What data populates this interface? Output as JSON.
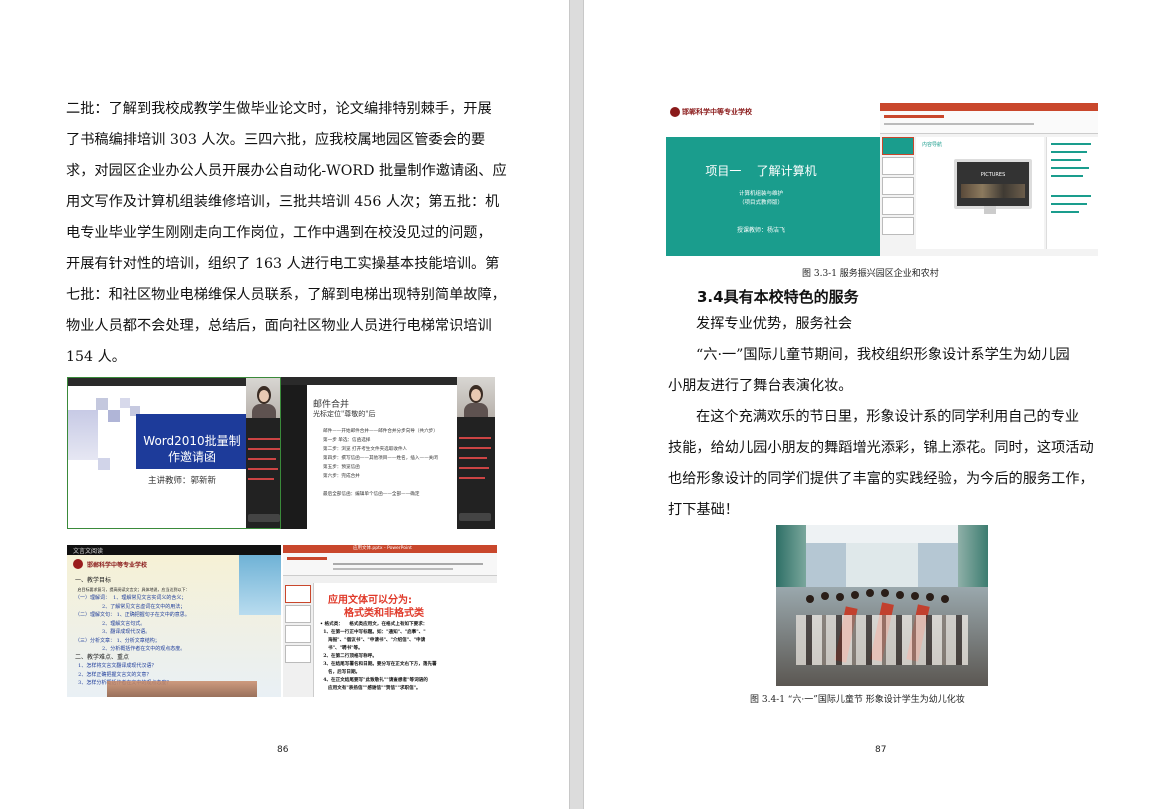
{
  "page86": {
    "lines": [
      "二批：了解到我校成教学生做毕业论文时，论文编排特别棘手，开展",
      "了书稿编排培训 303 人次。三四六批，应我校属地园区管委会的要",
      "求，对园区企业办公人员开展办公自动化-WORD 批量制作邀请函、应",
      "用文写作及计算机组装维修培训，三批共培训 456 人次；第五批：机",
      "电专业毕业学生刚刚走向工作岗位，工作中遇到在校没见过的问题，",
      "开展有针对性的培训，组织了 163 人进行电工实操基本技能培训。第",
      "七批：和社区物业电梯维保人员联系，了解到电梯出现特别简单故障，",
      "物业人员都不会处理，总结后，面向社区物业人员进行电梯常识培训",
      "154 人。"
    ],
    "fig1": {
      "title": "Word2010批量制作邀请函",
      "presenter": "主讲教师：郭新新"
    },
    "fig2": {
      "title": "邮件合并",
      "subtitle": "光标定位\"尊敬的\"后",
      "steps": [
        "邮件——开始邮件合并——邮件合并分步向导（共六步）",
        "第一步 单选：信函选择",
        "第二步：浏览  打开考生文件夹选取收件人",
        "第四步：撰写信函——其他项目——姓名，插入——关闭",
        "第五步：预览信函",
        "第六步：完成合并",
        "",
        "最后全部信函：编辑单个信函——全部——确定"
      ]
    },
    "fig3": {
      "window_title": "文言文阅读",
      "school_logo_text": "邯郸科学中等专业学校",
      "sections": [
        "一、教学目标",
        "  启目标要求复习，提高阅读文言文；具体地说，应当达到以下：",
        "（一）理解词：  1、理解常见文言实词义的含义；",
        "                 2、了解常见文言虚词在文中的用法；",
        "（二）理解文句： 1、正确把握句子在文中的意思。",
        "                 2、理解文言句式。",
        "                 3、翻译成现代汉语。",
        "（三）分析文章： 1、分析文章结构；",
        "                 2、分析概括作者在文中的观点态度。",
        "二、教学难点、重点",
        "  1、怎样将文言文翻译成现代汉语？",
        "  2、怎样正确把握文言文的文意？",
        "  3、怎样分析概括作者在文中的观点态度？"
      ]
    },
    "fig4": {
      "app_title": "应用文体.pptx - PowerPoint",
      "heading1": "应用文体可以分为:",
      "heading2": "格式类和非格式类",
      "bullets": [
        "• 格式类：    格式类应用文，在格式上有如下要求：",
        "  1、在第一行正中写标题。如：\"通知\"、\"启事\"、\"",
        "     海报\"、\"倡议书\"、\"申请书\"、\"介绍信\"、\"申请",
        "     书\"、\"聘书\"等。",
        "  2、在第二行顶格写称呼。",
        "  3、在结尾写署名和日期。要分写在正文右下方，落先署",
        "     名，后写日期。",
        "  4、在正文结尾要写\"此致敬礼\"\"请查想者\"等词语的",
        "     应用文有\"表扬信\"\"感谢信\"\"贺信\"\"求职信\"。"
      ]
    },
    "page_number": "86"
  },
  "page87": {
    "fig_top": {
      "logo_text": "邯郸科学中等专业学校",
      "title": "项目一    了解计算机",
      "sub1": "计算机组装与维护",
      "sub2": "（项目式教师版）",
      "teacher": "授课教师：杨洁飞",
      "ppt_panel_title": "内容导航",
      "ppt_pictures": "PICTURES"
    },
    "caption1": "图 3.3-1  服务振兴园区企业和农村",
    "heading": "3.4具有本校特色的服务",
    "line1": "发挥专业优势，服务社会",
    "para1_lines": [
      "“六·一”国际儿童节期间，我校组织形象设计系学生为幼儿园",
      "小朋友进行了舞台表演化妆。"
    ],
    "para2_lines": [
      "在这个充满欢乐的节日里，形象设计系的同学利用自己的专业",
      "技能，给幼儿园小朋友的舞蹈增光添彩，锦上添花。同时，这项活动",
      "也给形象设计的同学们提供了丰富的实践经验，为今后的服务工作，",
      "打下基础！"
    ],
    "caption2": "图 3.4-1 “六·一”国际儿童节 形象设计学生为幼儿化妆",
    "page_number": "87"
  },
  "colors": {
    "slide_blue": "#1d3b9a",
    "teal": "#1a9d8d",
    "ppt_orange": "#c9472c",
    "slide_red": "#e03a2a"
  }
}
